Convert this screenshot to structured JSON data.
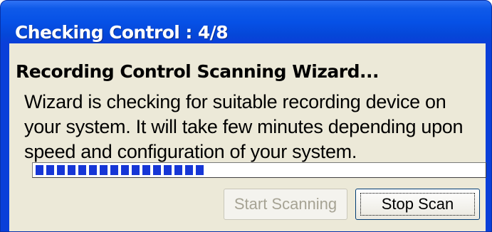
{
  "window": {
    "title": "Checking Control : 4/8"
  },
  "content": {
    "heading": "Recording Control Scanning Wizard...",
    "description_lines": [
      "Wizard is checking for suitable recording device on",
      "your system. It will take few minutes depending upon",
      "speed and configuration of your system."
    ]
  },
  "progress": {
    "value_percent": 38,
    "fill_color": "#1636d6"
  },
  "buttons": {
    "start_label": "Start Scanning",
    "stop_label": "Stop Scan"
  },
  "colors": {
    "titlebar": "#0651e6",
    "client_background": "#ece9d8"
  }
}
